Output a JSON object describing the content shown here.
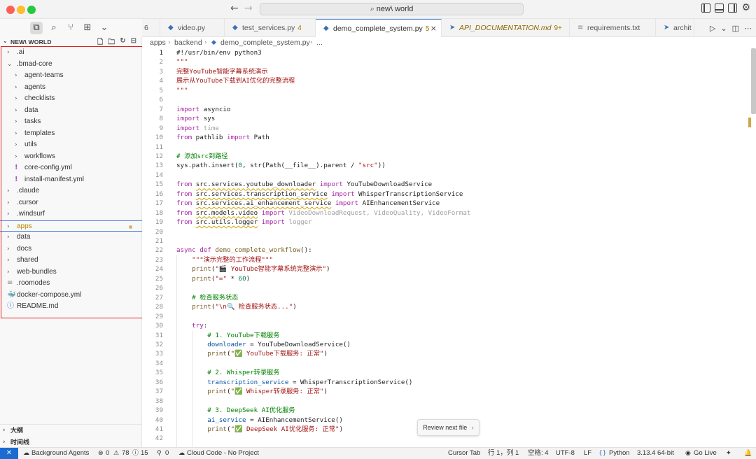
{
  "window": {
    "title": "new\\ world"
  },
  "sidebar": {
    "header": "NEW\\ WORLD",
    "tree": [
      {
        "label": ".ai",
        "type": "folder",
        "depth": 0
      },
      {
        "label": ".bmad-core",
        "type": "folder-open",
        "depth": 0
      },
      {
        "label": "agent-teams",
        "type": "folder",
        "depth": 1
      },
      {
        "label": "agents",
        "type": "folder",
        "depth": 1
      },
      {
        "label": "checklists",
        "type": "folder",
        "depth": 1
      },
      {
        "label": "data",
        "type": "folder",
        "depth": 1
      },
      {
        "label": "tasks",
        "type": "folder",
        "depth": 1
      },
      {
        "label": "templates",
        "type": "folder",
        "depth": 1
      },
      {
        "label": "utils",
        "type": "folder",
        "depth": 1
      },
      {
        "label": "workflows",
        "type": "folder",
        "depth": 1
      },
      {
        "label": "core-config.yml",
        "type": "yml",
        "depth": 1
      },
      {
        "label": "install-manifest.yml",
        "type": "yml",
        "depth": 1
      },
      {
        "label": ".claude",
        "type": "folder",
        "depth": 0
      },
      {
        "label": ".cursor",
        "type": "folder",
        "depth": 0
      },
      {
        "label": ".windsurf",
        "type": "folder",
        "depth": 0
      },
      {
        "label": "apps",
        "type": "folder",
        "depth": 0,
        "selected": true
      },
      {
        "label": "data",
        "type": "folder",
        "depth": 0
      },
      {
        "label": "docs",
        "type": "folder",
        "depth": 0
      },
      {
        "label": "shared",
        "type": "folder",
        "depth": 0
      },
      {
        "label": "web-bundles",
        "type": "folder",
        "depth": 0
      },
      {
        "label": ".roomodes",
        "type": "lines",
        "depth": 0
      },
      {
        "label": "docker-compose.yml",
        "type": "docker",
        "depth": 0
      },
      {
        "label": "README.md",
        "type": "info",
        "depth": 0
      }
    ],
    "outline_label": "大纲",
    "timeline_label": "时间线"
  },
  "tabs": [
    {
      "label": "6",
      "icon": ""
    },
    {
      "label": "video.py",
      "icon": "python"
    },
    {
      "label": "test_services.py",
      "count": "4",
      "icon": "python"
    },
    {
      "label": "demo_complete_system.py",
      "count": "5",
      "icon": "python",
      "active": true
    },
    {
      "label": "API_DOCUMENTATION.md",
      "count": "9+",
      "icon": "markdown",
      "italic": true
    },
    {
      "label": "requirements.txt",
      "icon": "lines"
    },
    {
      "label": "archit",
      "icon": "markdown"
    }
  ],
  "breadcrumb": [
    "apps",
    "backend",
    "demo_complete_system.py",
    "..."
  ],
  "code": [
    [
      [
        "dim0",
        "#!/usr/bin/env python3"
      ]
    ],
    [
      [
        "str",
        "\"\"\""
      ]
    ],
    [
      [
        "str",
        "完整YouTube智能字幕系统演示"
      ]
    ],
    [
      [
        "str",
        "展示从YouTube下载到AI优化的完整流程"
      ]
    ],
    [
      [
        "str",
        "\"\"\""
      ]
    ],
    [],
    [
      [
        "kw",
        "import"
      ],
      [
        "cls",
        " asyncio"
      ]
    ],
    [
      [
        "kw",
        "import"
      ],
      [
        "cls",
        " sys"
      ]
    ],
    [
      [
        "kw",
        "import"
      ],
      [
        "dim",
        " time"
      ]
    ],
    [
      [
        "kw",
        "from"
      ],
      [
        "cls",
        " pathlib "
      ],
      [
        "kw",
        "import"
      ],
      [
        "cls",
        " Path"
      ]
    ],
    [],
    [
      [
        "cmt",
        "# 添加src到路径"
      ]
    ],
    [
      [
        "cls",
        "sys.path.insert("
      ],
      [
        "num",
        "0"
      ],
      [
        "cls",
        ", str(Path(__file__).parent / "
      ],
      [
        "str",
        "\"src\""
      ],
      [
        "cls",
        "))"
      ]
    ],
    [],
    [
      [
        "kw",
        "from"
      ],
      [
        "cls",
        " "
      ],
      [
        "sq",
        "src.services.youtube_downloader"
      ],
      [
        "cls",
        " "
      ],
      [
        "kw",
        "import"
      ],
      [
        "cls",
        " YouTubeDownloadService"
      ]
    ],
    [
      [
        "kw",
        "from"
      ],
      [
        "cls",
        " "
      ],
      [
        "sq",
        "src.services.transcription_service"
      ],
      [
        "cls",
        " "
      ],
      [
        "kw",
        "import"
      ],
      [
        "cls",
        " WhisperTranscriptionService"
      ]
    ],
    [
      [
        "kw",
        "from"
      ],
      [
        "cls",
        " "
      ],
      [
        "sq",
        "src.services.ai_enhancement_service"
      ],
      [
        "cls",
        " "
      ],
      [
        "kw",
        "import"
      ],
      [
        "cls",
        " AIEnhancementService"
      ]
    ],
    [
      [
        "kw",
        "from"
      ],
      [
        "cls",
        " "
      ],
      [
        "sq",
        "src.models.video"
      ],
      [
        "cls",
        " "
      ],
      [
        "kw",
        "import"
      ],
      [
        "dim",
        " VideoDownloadRequest, VideoQuality, VideoFormat"
      ]
    ],
    [
      [
        "kw",
        "from"
      ],
      [
        "cls",
        " "
      ],
      [
        "sq",
        "src.utils.logger"
      ],
      [
        "cls",
        " "
      ],
      [
        "kw",
        "import"
      ],
      [
        "dim",
        " logger"
      ]
    ],
    [],
    [],
    [
      [
        "kw",
        "async def"
      ],
      [
        "cls",
        " "
      ],
      [
        "fn",
        "demo_complete_workflow"
      ],
      [
        "cls",
        "():"
      ]
    ],
    [
      [
        "cls",
        "    "
      ],
      [
        "str",
        "\"\"\"演示完整的工作流程\"\"\""
      ]
    ],
    [
      [
        "cls",
        "    "
      ],
      [
        "fn",
        "print"
      ],
      [
        "cls",
        "("
      ],
      [
        "str",
        "\"🎬 YouTube智能字幕系统完整演示\""
      ],
      [
        "cls",
        ")"
      ]
    ],
    [
      [
        "cls",
        "    "
      ],
      [
        "fn",
        "print"
      ],
      [
        "cls",
        "("
      ],
      [
        "str",
        "\"=\""
      ],
      [
        "cls",
        " * "
      ],
      [
        "num",
        "60"
      ],
      [
        "cls",
        ")"
      ]
    ],
    [],
    [
      [
        "cls",
        "    "
      ],
      [
        "cmt",
        "# 检查服务状态"
      ]
    ],
    [
      [
        "cls",
        "    "
      ],
      [
        "fn",
        "print"
      ],
      [
        "cls",
        "("
      ],
      [
        "str",
        "\"\\n🔍 检查服务状态...\""
      ],
      [
        "cls",
        ")"
      ]
    ],
    [],
    [
      [
        "cls",
        "    "
      ],
      [
        "kw",
        "try"
      ],
      [
        "cls",
        ":"
      ]
    ],
    [
      [
        "cls",
        "        "
      ],
      [
        "cmt",
        "# 1. YouTube下载服务"
      ]
    ],
    [
      [
        "cls",
        "        "
      ],
      [
        "dimv",
        "downloader"
      ],
      [
        "cls",
        " = YouTubeDownloadService()"
      ]
    ],
    [
      [
        "cls",
        "        "
      ],
      [
        "fn",
        "print"
      ],
      [
        "cls",
        "("
      ],
      [
        "str",
        "\"✅ YouTube下载服务: 正常\""
      ],
      [
        "cls",
        ")"
      ]
    ],
    [],
    [
      [
        "cls",
        "        "
      ],
      [
        "cmt",
        "# 2. Whisper转录服务"
      ]
    ],
    [
      [
        "cls",
        "        "
      ],
      [
        "var",
        "transcription_service"
      ],
      [
        "cls",
        " = WhisperTranscriptionService()"
      ]
    ],
    [
      [
        "cls",
        "        "
      ],
      [
        "fn",
        "print"
      ],
      [
        "cls",
        "("
      ],
      [
        "str",
        "\"✅ Whisper转录服务: 正常\""
      ],
      [
        "cls",
        ")"
      ]
    ],
    [],
    [
      [
        "cls",
        "        "
      ],
      [
        "cmt",
        "# 3. DeepSeek AI优化服务"
      ]
    ],
    [
      [
        "cls",
        "        "
      ],
      [
        "var",
        "ai_service"
      ],
      [
        "cls",
        " = AIEnhancementService()"
      ]
    ],
    [
      [
        "cls",
        "        "
      ],
      [
        "fn",
        "print"
      ],
      [
        "cls",
        "("
      ],
      [
        "str",
        "\"✅ DeepSeek AI优化服务: 正常\""
      ],
      [
        "cls",
        ")"
      ]
    ],
    []
  ],
  "review_button": "Review next file",
  "review_chevron": "›",
  "statusbar": {
    "background_agents": "Background Agents",
    "errors": "0",
    "warnings": "78",
    "info": "15",
    "ports": "0",
    "cloud": "Cloud Code - No Project",
    "tab_mode": "Cursor Tab",
    "position": "行 1，列 1",
    "spaces": "空格: 4",
    "encoding": "UTF-8",
    "eol": "LF",
    "language": "Python",
    "interpreter": "3.13.4 64-bit",
    "golive": "Go Live"
  },
  "colors": {
    "accent": "#1a6bd2",
    "selection_border": "#4a7fd8",
    "highlight_box": "#e02020",
    "modified": "#a57b00"
  }
}
